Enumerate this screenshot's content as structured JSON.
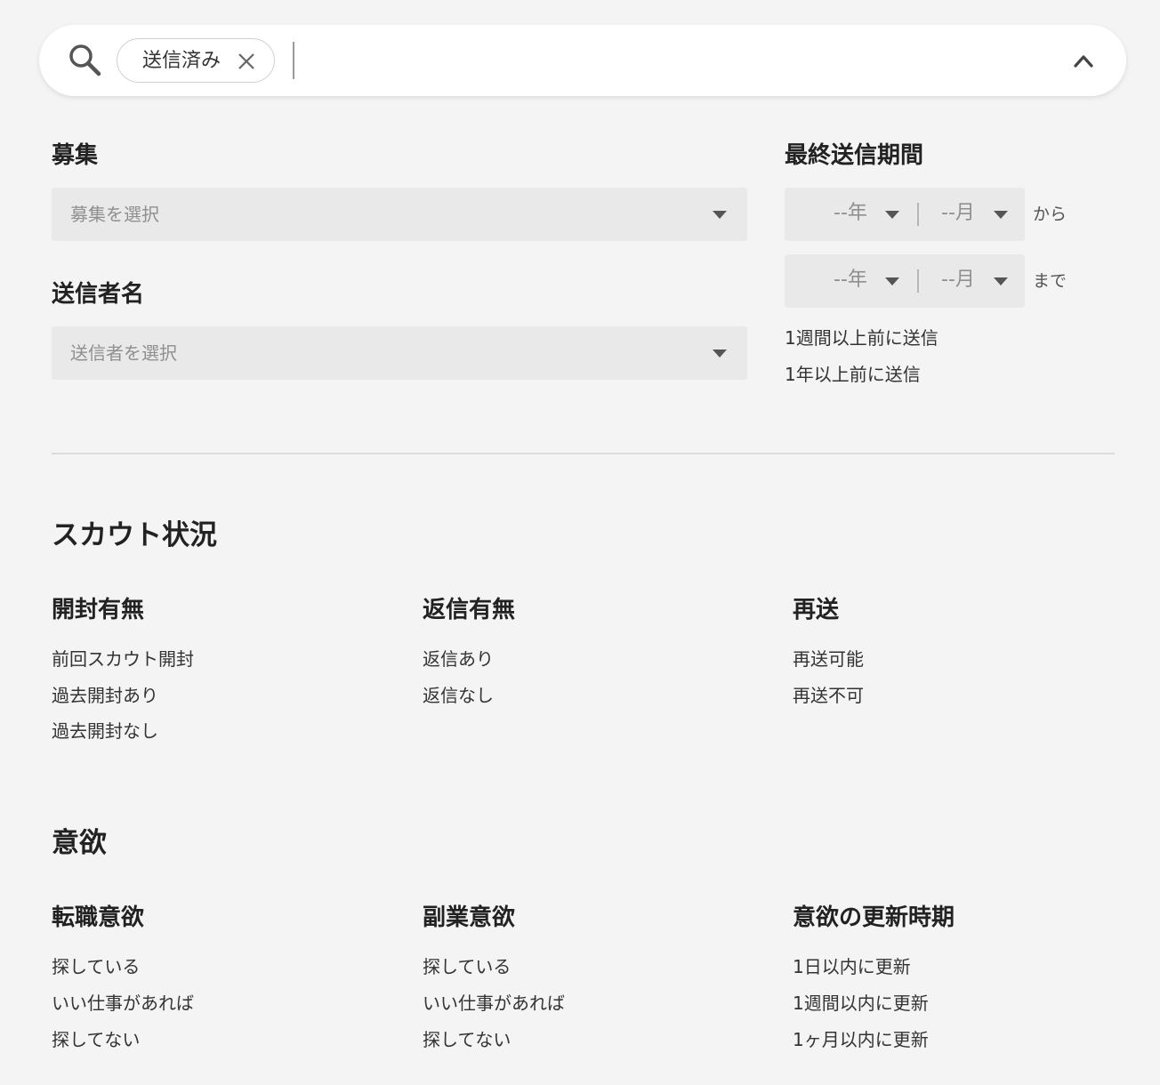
{
  "search": {
    "chip_label": "送信済み",
    "input_value": "",
    "placeholder": ""
  },
  "filters": {
    "recruitment": {
      "label": "募集",
      "placeholder": "募集を選択"
    },
    "sender": {
      "label": "送信者名",
      "placeholder": "送信者を選択"
    },
    "last_sent": {
      "label": "最終送信期間",
      "year_placeholder": "--年",
      "month_placeholder": "--月",
      "from_word": "から",
      "to_word": "まで",
      "quick_options": [
        "1週間以上前に送信",
        "1年以上前に送信"
      ]
    }
  },
  "scout_status": {
    "title": "スカウト状況",
    "groups": [
      {
        "title": "開封有無",
        "options": [
          "前回スカウト開封",
          "過去開封あり",
          "過去開封なし"
        ]
      },
      {
        "title": "返信有無",
        "options": [
          "返信あり",
          "返信なし"
        ]
      },
      {
        "title": "再送",
        "options": [
          "再送可能",
          "再送不可"
        ]
      }
    ]
  },
  "motivation": {
    "title": "意欲",
    "groups": [
      {
        "title": "転職意欲",
        "options": [
          "探している",
          "いい仕事があれば",
          "探してない"
        ]
      },
      {
        "title": "副業意欲",
        "options": [
          "探している",
          "いい仕事があれば",
          "探してない"
        ]
      },
      {
        "title": "意欲の更新時期",
        "options": [
          "1日以内に更新",
          "1週間以内に更新",
          "1ヶ月以内に更新"
        ]
      }
    ]
  },
  "icons": {
    "search": "search-icon",
    "chip_close": "close-icon",
    "collapse": "chevron-up-icon",
    "dropdown": "caret-down-icon"
  }
}
